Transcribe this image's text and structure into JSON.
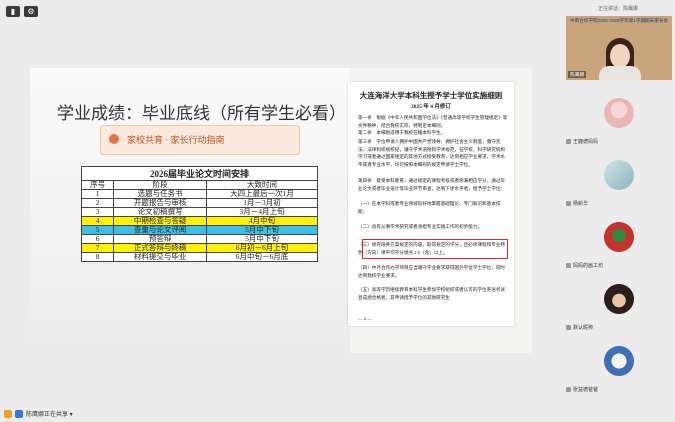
{
  "toolbar": {
    "btn1": "▮",
    "btn2": "⚙"
  },
  "slide": {
    "title": "学业成绩：毕业底线（所有学生必看）",
    "guide": "家校共育 · 家长行动指南",
    "table": {
      "caption": "2026届毕业论文时间安排",
      "headers": [
        "序号",
        "阶段",
        "大致时间"
      ],
      "rows": [
        {
          "no": "1",
          "stage": "选题与任务书",
          "time": "大四上最后一次1月",
          "hl": ""
        },
        {
          "no": "2",
          "stage": "开题报告与审核",
          "time": "1月－3月初",
          "hl": ""
        },
        {
          "no": "3",
          "stage": "论文初稿撰写",
          "time": "3月－4月上旬",
          "hl": ""
        },
        {
          "no": "4",
          "stage": "中期检查与答疑",
          "time": "4月中旬",
          "hl": "yellow"
        },
        {
          "no": "5",
          "stage": "查重与论文评阅",
          "time": "5月中下旬",
          "hl": "cyan"
        },
        {
          "no": "6",
          "stage": "预答辩",
          "time": "5月中下旬",
          "hl": ""
        },
        {
          "no": "7",
          "stage": "正式答辩与终稿",
          "time": "6月初－6月上旬",
          "hl": "yellow"
        },
        {
          "no": "8",
          "stage": "材料提交与毕业",
          "time": "6月中旬－6月底",
          "hl": ""
        }
      ]
    }
  },
  "doc": {
    "title": "大连海洋大学本科生授予学士学位实施细则",
    "date": "2025 年 4 月修订",
    "paragraphs": [
      "第一条　根据《中华人民共和国学位法》《普通高等学校学生管理规定》等文件精神，结合我校实际，特制定本细则。",
      "第二条　本细则适用于我校在籍本科学生。",
      "第三条　学位申请人拥护中国共产党领导，拥护社会主义制度，遵守宪法、法律和校规校纪，遵守学术道德和学术规范，在学校、科学研究机构学习或者通过国家规定的其他方式接受教育，达到相应学业要求，学术水平或者专业水平，均可按照本细则的规定申请学士学位。",
      "第四条　接受本科教育，通过规定的课程考核或者修满相应学分，通过毕业论文或者毕业设计等毕业环节审查，达到下述水平者，授予学士学位：",
      "（一）在本学科或者专业领域较好地掌握基础理论、专门知识和基本技能；",
      "（二）具有从事学术研究或者承担专业实践工作的初步能力。",
      "（三）修完培养方案规定的内容，取得规定的学分，且必修课程和专业特色（方向）课平均学分绩点 2.0（含）以上。",
      "（四）中外合作办学项目应当遵守学业要求获得国外学位学士学位，同时达到我校学业要求。",
      "（五）高等学历继续教育本科学生参加学校组织或者认可的学位英语考试且成绩合格者，其申请授予学位的其他研究生"
    ],
    "footer": "— 2 —"
  },
  "status": {
    "sharing": "陈鹰娜正在共享 ▾"
  },
  "right_panel": {
    "header": "正在讲话：陈鹰娜",
    "presenter_banner": "中南合作学院2025-2026学年第1学期期末家长会",
    "presenter_name": "陈鹰娜",
    "participants": [
      {
        "name": "王鹿德妈妈"
      },
      {
        "name": "杨新华"
      },
      {
        "name": "妈妈的画工坊"
      },
      {
        "name": "默认昵称"
      },
      {
        "name": "张益德爸爸"
      }
    ]
  }
}
